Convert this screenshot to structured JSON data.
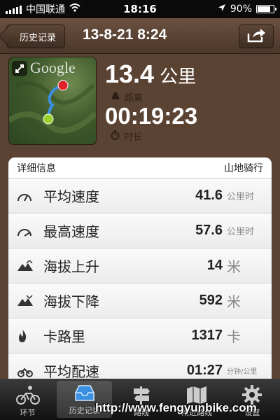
{
  "status_bar": {
    "carrier": "中国联通",
    "time": "18:16",
    "battery": "90%",
    "battery_level": 0.9
  },
  "nav": {
    "back_label": "历史记录",
    "title": "13-8-21 8:24",
    "share_icon": "share-icon"
  },
  "map": {
    "logo": "Google",
    "expand_icon": "expand-icon"
  },
  "summary": {
    "distance_value": "13.4",
    "distance_unit": "公里",
    "distance_label": "距离",
    "duration_value": "00:19:23",
    "duration_label": "时长"
  },
  "details": {
    "header": "详细信息",
    "activity": "山地骑行",
    "rows": [
      {
        "icon": "speedometer-icon",
        "label": "平均速度",
        "value": "41.6",
        "unit": "公里时"
      },
      {
        "icon": "max-speed-icon",
        "label": "最高速度",
        "value": "57.6",
        "unit": "公里时"
      },
      {
        "icon": "mountain-up-icon",
        "label": "海拔上升",
        "value": "14",
        "unit": "米"
      },
      {
        "icon": "mountain-down-icon",
        "label": "海拔下降",
        "value": "592",
        "unit": "米"
      },
      {
        "icon": "flame-icon",
        "label": "卡路里",
        "value": "1317",
        "unit": "卡"
      },
      {
        "icon": "pace-icon",
        "label": "平均配速",
        "value": "01:27",
        "unit": "分钟/公里"
      }
    ]
  },
  "tabs": [
    {
      "label": "环节",
      "icon": "cyclist-icon"
    },
    {
      "label": "历史记录",
      "icon": "history-tray-icon"
    },
    {
      "label": "路线",
      "icon": "signpost-icon"
    },
    {
      "label": "附近路线",
      "icon": "map-icon"
    },
    {
      "label": "设置",
      "icon": "gear-icon"
    }
  ],
  "watermark": "http://www.fengyunbike.com",
  "colors": {
    "header_brown": "#5b4334",
    "start_marker": "#9bd32e",
    "end_marker": "#e2222a",
    "route": "#3a8fe0"
  }
}
